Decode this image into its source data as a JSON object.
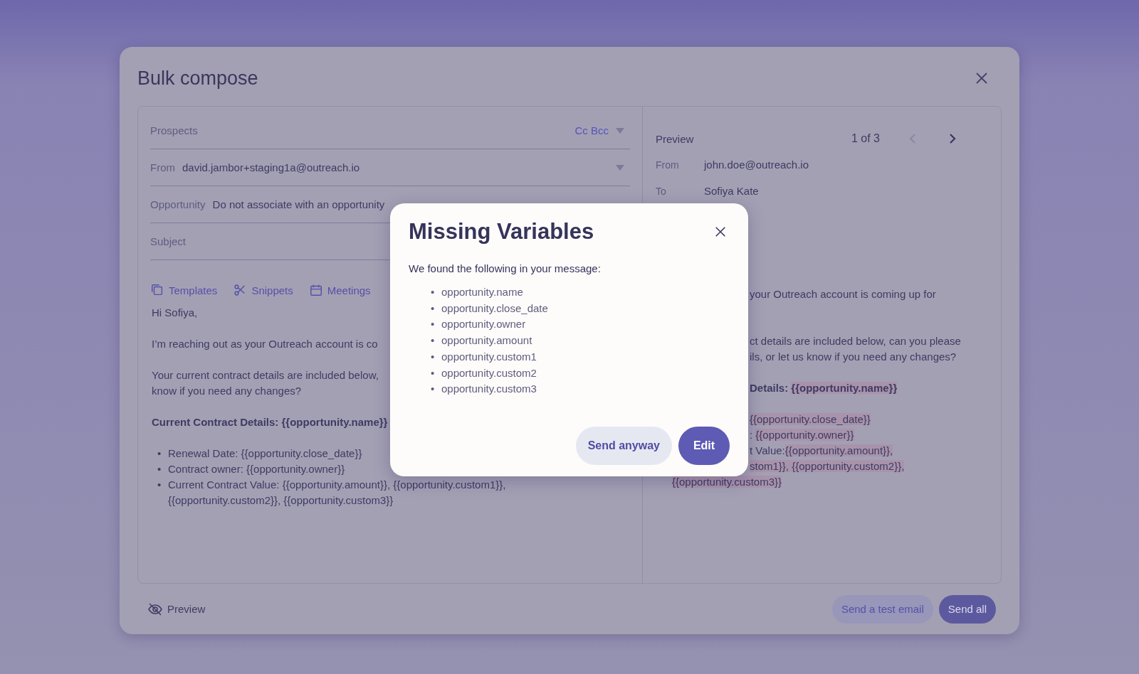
{
  "composer": {
    "title": "Bulk compose",
    "prospects": {
      "placeholder": "Prospects",
      "links": [
        "Cc Bcc"
      ]
    },
    "from": {
      "label": "From",
      "value": "david.jambor+staging1a@outreach.io"
    },
    "opportunity": {
      "label": "Opportunity",
      "value": "Do not associate with an opportunity"
    },
    "subject": {
      "placeholder": "Subject"
    },
    "toolbar": [
      {
        "kind": "templates",
        "label": "Templates"
      },
      {
        "kind": "snippets",
        "label": "Snippets"
      },
      {
        "kind": "meetings",
        "label": "Meetings"
      }
    ],
    "body": [
      {
        "kind": "para",
        "lines": [
          "Hi Sofiya,"
        ]
      },
      {
        "kind": "para",
        "lines": [
          "I’m reaching out as your Outreach account is co"
        ]
      },
      {
        "kind": "para",
        "lines": [
          "Your current contract details are included below,",
          "know if you need any changes?"
        ]
      },
      {
        "kind": "heading",
        "lines": [
          "Current Contract Details: {{opportunity.name}}"
        ]
      },
      {
        "kind": "bullets",
        "marker": "•",
        "items": [
          [
            "Renewal Date: {{opportunity.close_date}}"
          ],
          [
            "Contract owner: {{opportunity.owner}}"
          ],
          [
            "Current Contract Value: {{opportunity.amount}}, {{opportunity.custom1}},",
            "{{opportunity.custom2}}, {{opportunity.custom3}}"
          ]
        ]
      }
    ]
  },
  "preview": {
    "label": "Preview",
    "pager": "1 of 3",
    "prev_disabled": true,
    "next_disabled": false,
    "from_label": "From",
    "from": "john.doe@outreach.io",
    "to_label": "To",
    "to": "Sofiya Kate",
    "body": [
      {
        "kind": "para",
        "lines": [
          {
            "clipped": true,
            "segments": [
              {
                "text": "your Outreach account is coming up for",
                "missing": false
              }
            ]
          }
        ]
      },
      {
        "kind": "para",
        "lines": [
          {
            "clipped": true,
            "segments": [
              {
                "text": "ct details are included below, can you please",
                "missing": false
              }
            ]
          },
          {
            "clipped": true,
            "segments": [
              {
                "text": "ils, or let us know if you need any changes?",
                "missing": false
              }
            ]
          }
        ]
      },
      {
        "kind": "heading",
        "lines": [
          {
            "clipped": true,
            "segments": [
              {
                "text": "Details: ",
                "missing": false
              },
              {
                "text": "{{opportunity.name}}",
                "missing": true
              }
            ]
          }
        ]
      },
      {
        "kind": "para",
        "lines": [
          {
            "clipped": true,
            "segments": [
              {
                "text": "{{opportunity.close_date}}",
                "missing": true
              }
            ]
          },
          {
            "clipped": true,
            "segments": [
              {
                "text": ": ",
                "missing": false
              },
              {
                "text": "{{opportunity.owner}}",
                "missing": true
              }
            ]
          },
          {
            "clipped": true,
            "segments": [
              {
                "text": "t Value:",
                "missing": false
              },
              {
                "text": "{{opportunity.amount}},",
                "missing": true
              }
            ]
          },
          {
            "clipped": true,
            "segments": [
              {
                "text": "stom1}}, {{opportunity.custom2}},",
                "missing": true
              }
            ]
          },
          {
            "clipped": false,
            "segments": [
              {
                "text": "{{opportunity.custom3}}",
                "missing": true
              }
            ]
          }
        ]
      }
    ]
  },
  "footer": {
    "preview_toggle": "Preview",
    "test_button": "Send a test email",
    "send_button": "Send all"
  },
  "dialog": {
    "title": "Missing Variables",
    "intro": "We found the following in your message:",
    "marker": "•",
    "variables": [
      "opportunity.name",
      "opportunity.close_date",
      "opportunity.owner",
      "opportunity.amount",
      "opportunity.custom1",
      "opportunity.custom2",
      "opportunity.custom3"
    ],
    "secondary_button": "Send anyway",
    "primary_button": "Edit"
  }
}
